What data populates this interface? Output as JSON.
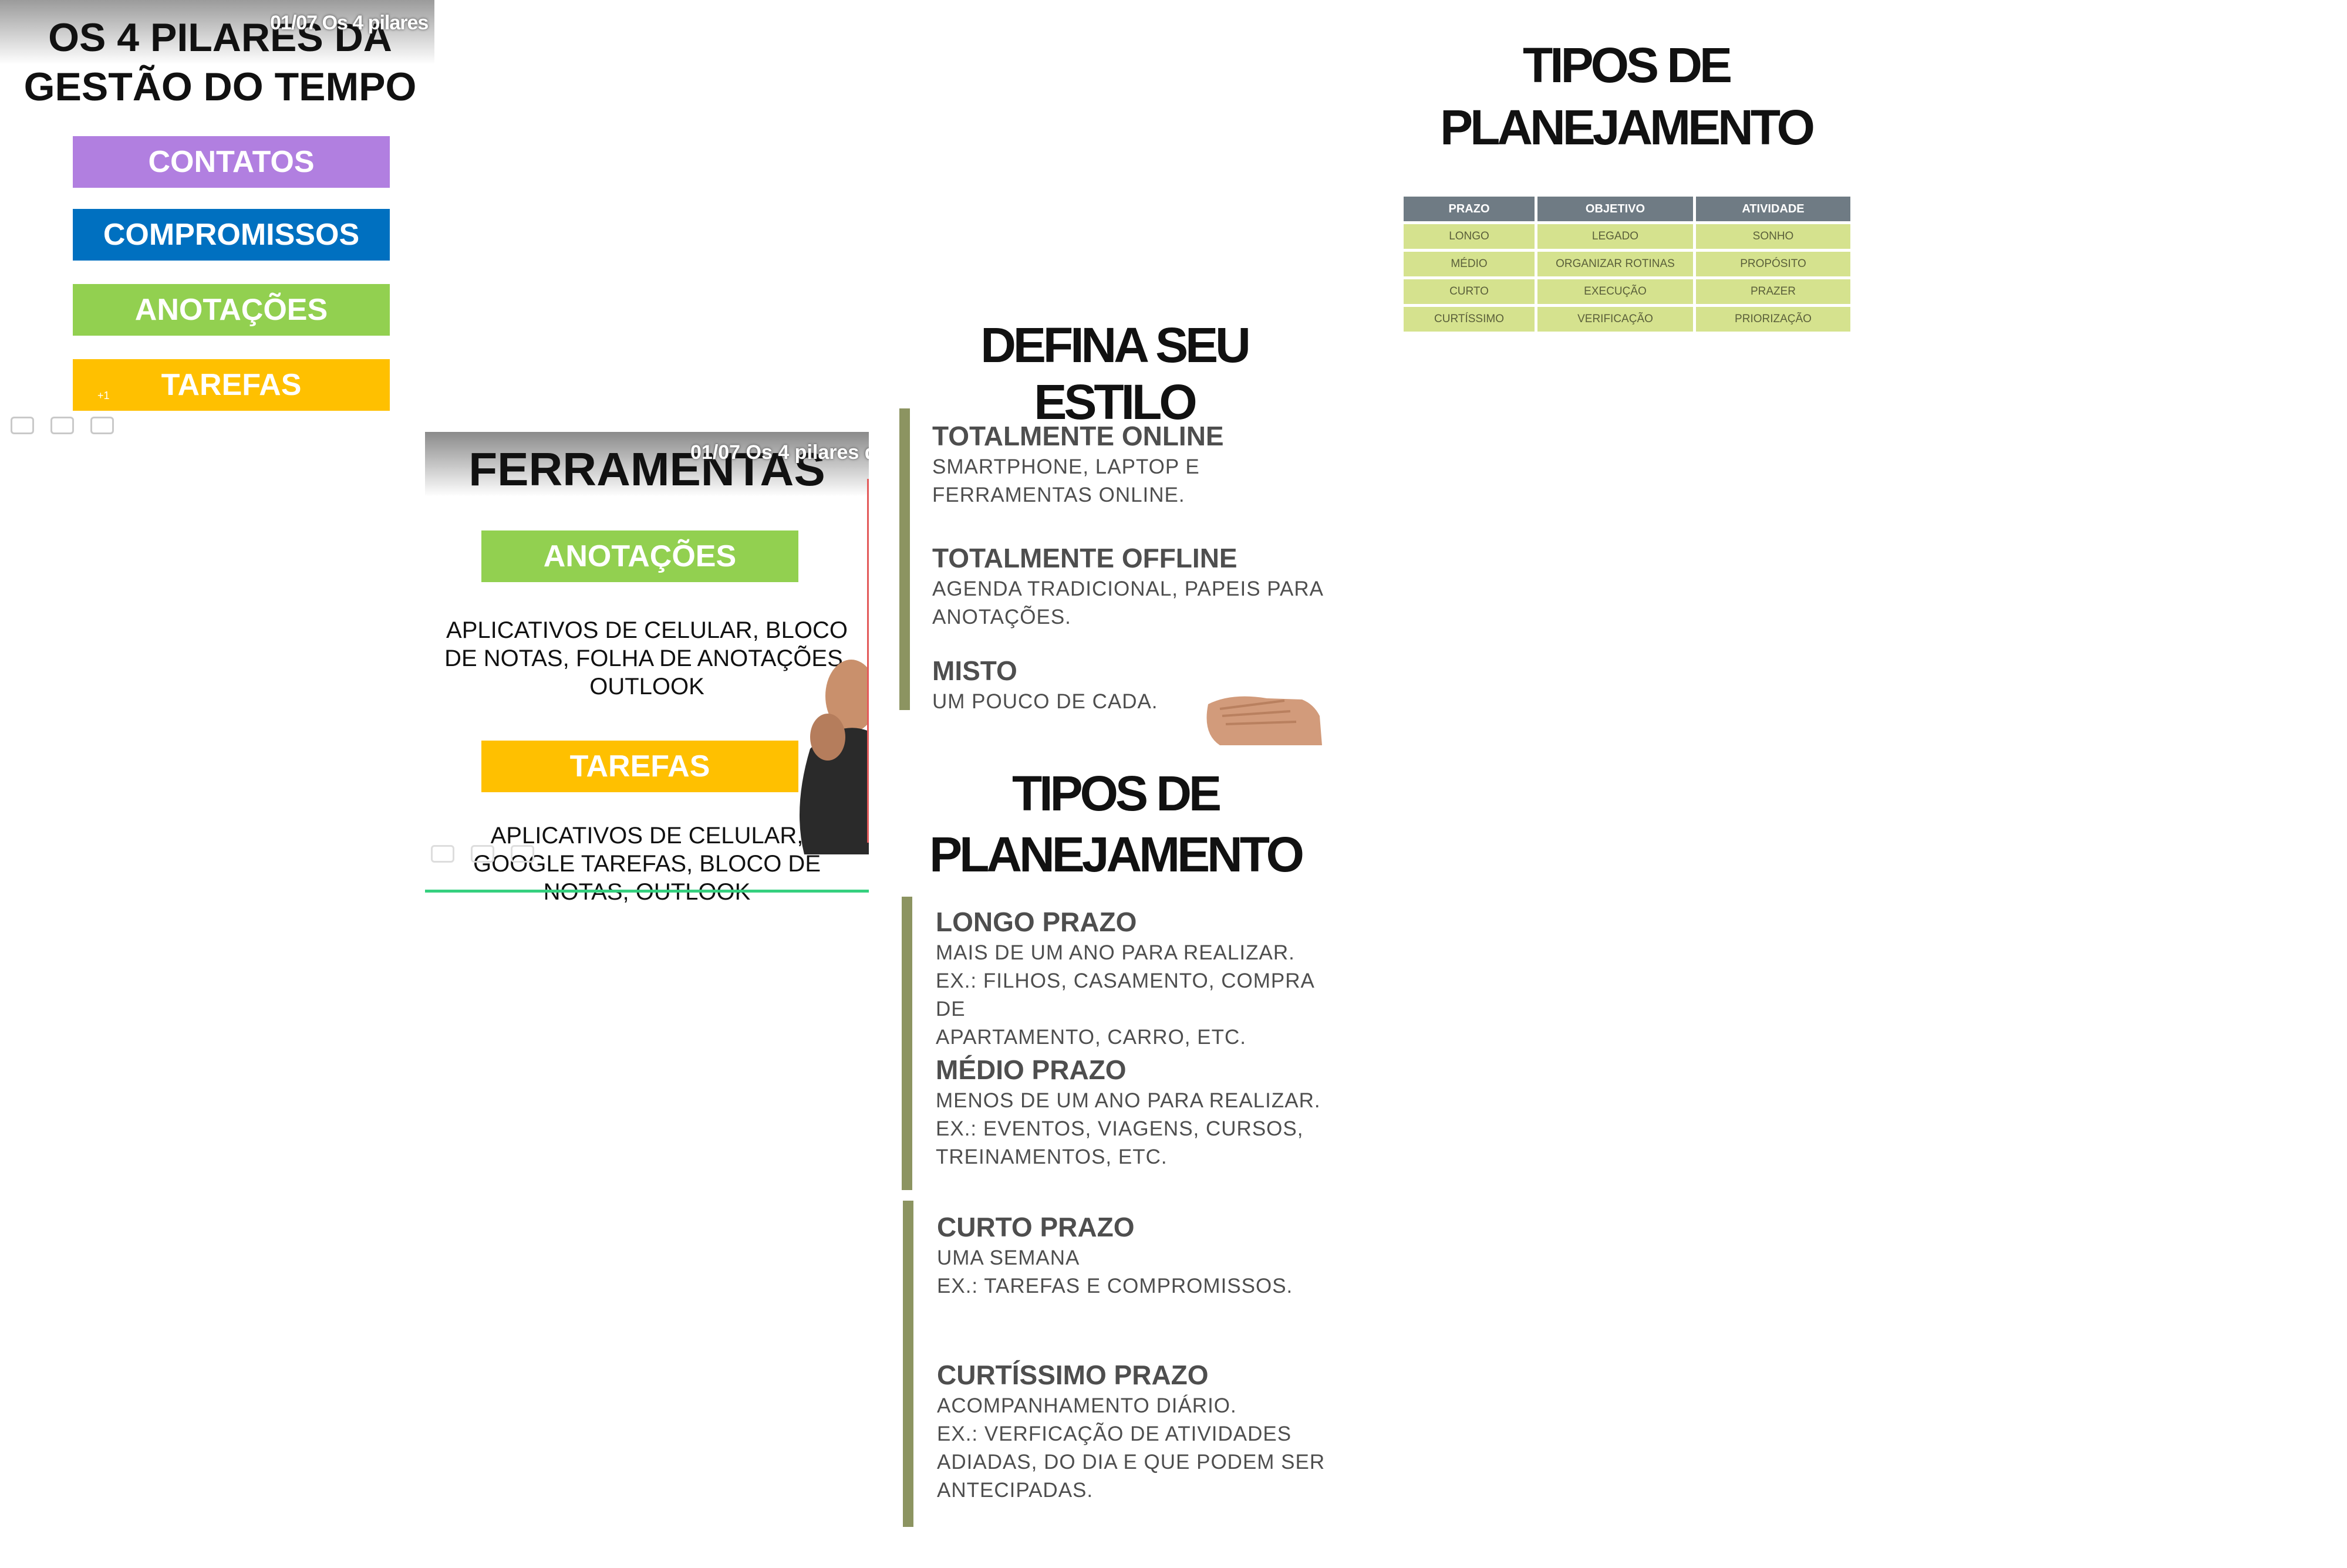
{
  "panel_pilares": {
    "video_title": "01/07 Os 4 pilares",
    "title_line1": "OS 4 PILARES DA",
    "title_line2": "GESTÃO DO TEMPO",
    "items": [
      {
        "label": "CONTATOS",
        "color": "#b17fe0"
      },
      {
        "label": "COMPROMISSOS",
        "color": "#0070c0"
      },
      {
        "label": "ANOTAÇÕES",
        "color": "#92d050"
      },
      {
        "label": "TAREFAS",
        "color": "#ffc000"
      }
    ],
    "small_mark": "+1"
  },
  "panel_ferramentas": {
    "video_title": "01/07 Os 4 pilares d",
    "title": "FERRAMENTAS",
    "anotacoes_label": "ANOTAÇÕES",
    "anotacoes_text": "APLICATIVOS DE CELULAR, BLOCO DE NOTAS, FOLHA DE ANOTAÇÕES, OUTLOOK",
    "tarefas_label": "TAREFAS",
    "tarefas_text": "APLICATIVOS DE CELULAR, GOOGLE TAREFAS, BLOCO DE NOTAS, OUTLOOK",
    "colors": {
      "anotacoes": "#92d050",
      "tarefas": "#ffc000"
    }
  },
  "panel_estilo": {
    "title": "DEFINA SEU ESTILO",
    "items": [
      {
        "heading": "TOTALMENTE ONLINE",
        "text": "SMARTPHONE, LAPTOP E FERRAMENTAS ONLINE."
      },
      {
        "heading": "TOTALMENTE OFFLINE",
        "text": "AGENDA TRADICIONAL, PAPEIS PARA ANOTAÇÕES."
      },
      {
        "heading": "MISTO",
        "text": "UM POUCO DE CADA."
      }
    ],
    "bar_color": "#8c9461"
  },
  "panel_tipos": {
    "title_line1": "TIPOS DE",
    "title_line2": "PLANEJAMENTO",
    "items": [
      {
        "heading": "LONGO PRAZO",
        "lines": [
          "MAIS DE UM ANO PARA REALIZAR.",
          "EX.: FILHOS, CASAMENTO, COMPRA DE",
          "APARTAMENTO, CARRO, ETC."
        ]
      },
      {
        "heading": "MÉDIO PRAZO",
        "lines": [
          "MENOS DE UM ANO PARA REALIZAR.",
          "EX.: EVENTOS, VIAGENS, CURSOS,",
          "TREINAMENTOS, ETC."
        ]
      },
      {
        "heading": "CURTO PRAZO",
        "lines": [
          "UMA SEMANA",
          "EX.: TAREFAS E COMPROMISSOS."
        ]
      },
      {
        "heading": "CURTÍSSIMO PRAZO",
        "lines": [
          "ACOMPANHAMENTO DIÁRIO.",
          "EX.: VERFICAÇÃO DE ATIVIDADES",
          "ADIADAS, DO DIA E QUE PODEM SER",
          "ANTECIPADAS."
        ]
      }
    ]
  },
  "panel_tabela": {
    "title_line1": "TIPOS DE",
    "title_line2": "PLANEJAMENTO",
    "headers": [
      "PRAZO",
      "OBJETIVO",
      "ATIVIDADE"
    ],
    "rows": [
      [
        "LONGO",
        "LEGADO",
        "SONHO"
      ],
      [
        "MÉDIO",
        "ORGANIZAR ROTINAS",
        "PROPÓSITO"
      ],
      [
        "CURTO",
        "EXECUÇÃO",
        "PRAZER"
      ],
      [
        "CURTÍSSIMO",
        "VERIFICAÇÃO",
        "PRIORIZAÇÃO"
      ]
    ]
  }
}
